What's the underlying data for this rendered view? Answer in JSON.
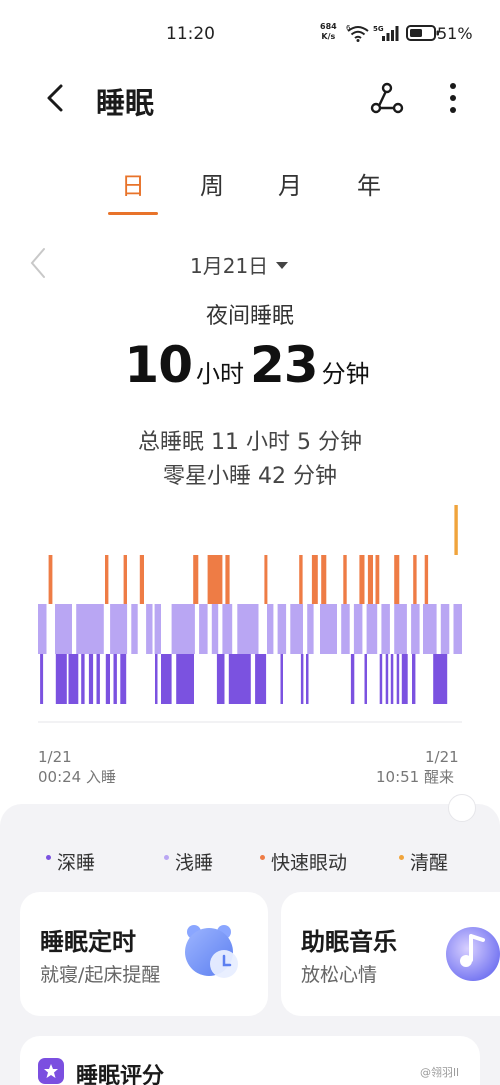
{
  "status_bar": {
    "time": "11:20",
    "net_speed_value": "684",
    "net_speed_unit": "K/s",
    "wifi_badge": "6",
    "signal_badge": "5G",
    "battery_percent": "51%"
  },
  "header": {
    "title": "睡眠",
    "back_icon": "chevron-left-icon",
    "share_icon": "share-icon",
    "more_icon": "more-vertical-icon"
  },
  "tabs": [
    {
      "label": "日",
      "active": true
    },
    {
      "label": "周",
      "active": false
    },
    {
      "label": "月",
      "active": false
    },
    {
      "label": "年",
      "active": false
    }
  ],
  "date": {
    "label": "1月21日"
  },
  "summary": {
    "title": "夜间睡眠",
    "hours": "10",
    "hours_unit": "小时",
    "minutes": "23",
    "minutes_unit": "分钟",
    "total": "总睡眠 11 小时 5 分钟",
    "nap": "零星小睡 42 分钟"
  },
  "chart_data": {
    "type": "bar",
    "x_start": {
      "date": "1/21",
      "time": "00:24 入睡"
    },
    "x_end": {
      "date": "1/21",
      "time": "10:51 醒来"
    },
    "stages_order": [
      "清醒",
      "快速眼动",
      "浅睡",
      "深睡"
    ],
    "colors": {
      "深睡": "#7b52e0",
      "浅睡": "#b9a6f3",
      "快速眼动": "#ee7c45",
      "清醒": "#f0a43c"
    },
    "segments": {
      "清醒": [
        [
          98.2,
          99.0
        ]
      ],
      "快速眼动": [
        [
          2.5,
          3.4
        ],
        [
          15.8,
          16.6
        ],
        [
          20.2,
          21.0
        ],
        [
          24.0,
          25.0
        ],
        [
          36.6,
          37.8
        ],
        [
          40.0,
          43.5
        ],
        [
          44.2,
          45.2
        ],
        [
          53.4,
          54.1
        ],
        [
          61.6,
          62.4
        ],
        [
          64.6,
          66.0
        ],
        [
          66.8,
          68.0
        ],
        [
          72.0,
          72.8
        ],
        [
          75.8,
          77.0
        ],
        [
          77.8,
          79.0
        ],
        [
          79.6,
          80.5
        ],
        [
          84.0,
          85.2
        ],
        [
          88.5,
          89.3
        ],
        [
          91.2,
          92.0
        ]
      ],
      "浅睡": [
        [
          0,
          2.0
        ],
        [
          4.0,
          8.0
        ],
        [
          9.0,
          15.5
        ],
        [
          17.0,
          21.0
        ],
        [
          22.0,
          23.5
        ],
        [
          25.5,
          27.0
        ],
        [
          27.5,
          29.0
        ],
        [
          31.5,
          37.0
        ],
        [
          38.0,
          40.0
        ],
        [
          41.0,
          42.5
        ],
        [
          43.5,
          45.8
        ],
        [
          47.0,
          52.0
        ],
        [
          54.0,
          55.5
        ],
        [
          56.5,
          58.5
        ],
        [
          59.5,
          62.5
        ],
        [
          63.5,
          65.0
        ],
        [
          66.5,
          70.5
        ],
        [
          71.5,
          73.5
        ],
        [
          74.5,
          76.5
        ],
        [
          77.5,
          80.0
        ],
        [
          81.0,
          83.0
        ],
        [
          84.0,
          87.0
        ],
        [
          88.0,
          90.0
        ],
        [
          90.8,
          94.0
        ],
        [
          95.0,
          97.0
        ],
        [
          98.0,
          100
        ]
      ],
      "深睡": [
        [
          0.5,
          1.2
        ],
        [
          4.2,
          6.8
        ],
        [
          7.2,
          9.5
        ],
        [
          10.2,
          11.0
        ],
        [
          12.0,
          13.0
        ],
        [
          13.8,
          14.6
        ],
        [
          16.0,
          17.0
        ],
        [
          17.8,
          18.6
        ],
        [
          19.4,
          20.8
        ],
        [
          27.6,
          28.2
        ],
        [
          29.0,
          31.5
        ],
        [
          32.6,
          36.8
        ],
        [
          42.2,
          44.0
        ],
        [
          45.0,
          50.2
        ],
        [
          51.2,
          53.8
        ],
        [
          57.2,
          57.8
        ],
        [
          62.0,
          62.6
        ],
        [
          63.2,
          63.8
        ],
        [
          73.8,
          74.6
        ],
        [
          77.0,
          77.6
        ],
        [
          80.6,
          81.2
        ],
        [
          82.0,
          82.6
        ],
        [
          83.2,
          83.8
        ],
        [
          84.6,
          85.2
        ],
        [
          85.8,
          87.2
        ],
        [
          88.2,
          89.0
        ],
        [
          93.2,
          96.5
        ]
      ]
    }
  },
  "legend": [
    {
      "label": "深睡",
      "color": "#7b52e0"
    },
    {
      "label": "浅睡",
      "color": "#b9a6f3"
    },
    {
      "label": "快速眼动",
      "color": "#ee7c45"
    },
    {
      "label": "清醒",
      "color": "#f0a43c"
    }
  ],
  "cards": {
    "timer": {
      "title": "睡眠定时",
      "subtitle": "就寝/起床提醒",
      "icon": "alarm-clock-icon"
    },
    "music": {
      "title": "助眠音乐",
      "subtitle": "放松心情",
      "icon": "music-note-icon"
    }
  },
  "score": {
    "title": "睡眠评分",
    "icon": "star-icon"
  },
  "watermark": "@翎羽ll"
}
